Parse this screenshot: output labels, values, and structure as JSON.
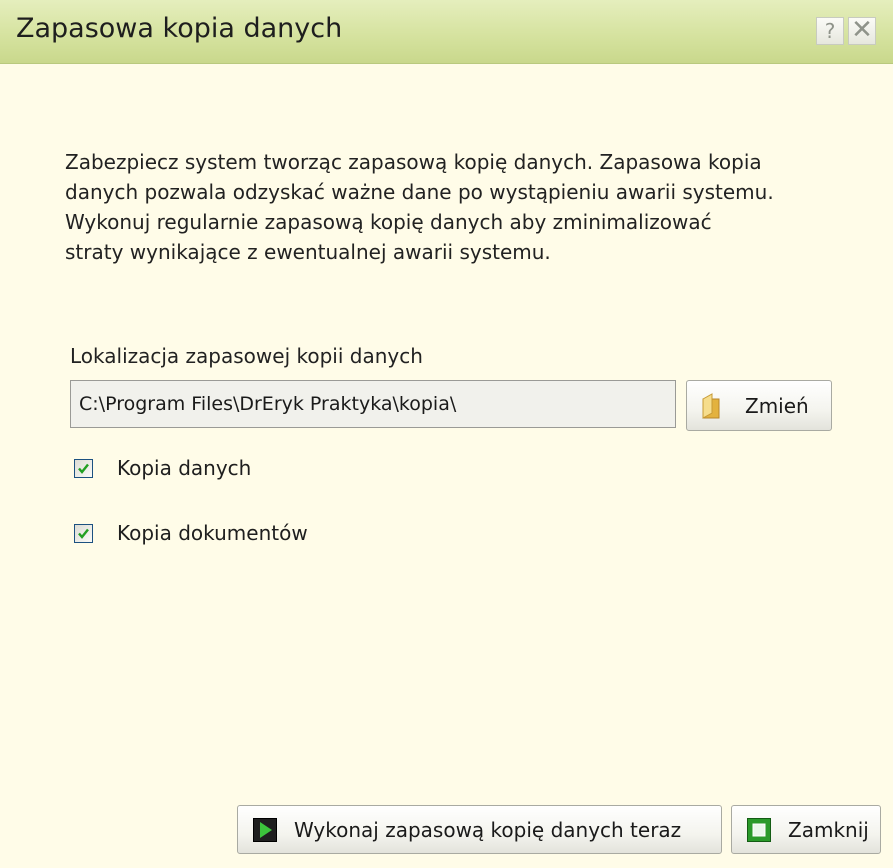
{
  "window": {
    "title": "Zapasowa kopia danych",
    "help_glyph": "?",
    "close_glyph": "✕"
  },
  "description": {
    "lines": [
      "Zabezpiecz system tworząc zapasową kopię danych. Zapasowa kopia",
      "danych pozwala odzyskać ważne dane po wystąpieniu awarii systemu.",
      "Wykonuj regularnie zapasową kopię danych aby zminimalizować",
      "straty wynikające z ewentualnej awarii systemu."
    ]
  },
  "location": {
    "label": "Lokalizacja zapasowej kopii danych",
    "path": "C:\\Program Files\\DrEryk Praktyka\\kopia\\",
    "change_button": "Zmień",
    "change_icon": "folder-icon"
  },
  "options": [
    {
      "label": "Kopia danych",
      "checked": true
    },
    {
      "label": "Kopia dokumentów",
      "checked": true
    }
  ],
  "footer": {
    "backup_button": "Wykonaj zapasową kopię danych teraz",
    "backup_icon": "play-icon",
    "close_button": "Zamknij",
    "close_icon": "close-box-icon"
  },
  "colors": {
    "titlebar": "#d6e3a0",
    "background": "#fffce8",
    "icon_green": "#2f9a2f"
  }
}
